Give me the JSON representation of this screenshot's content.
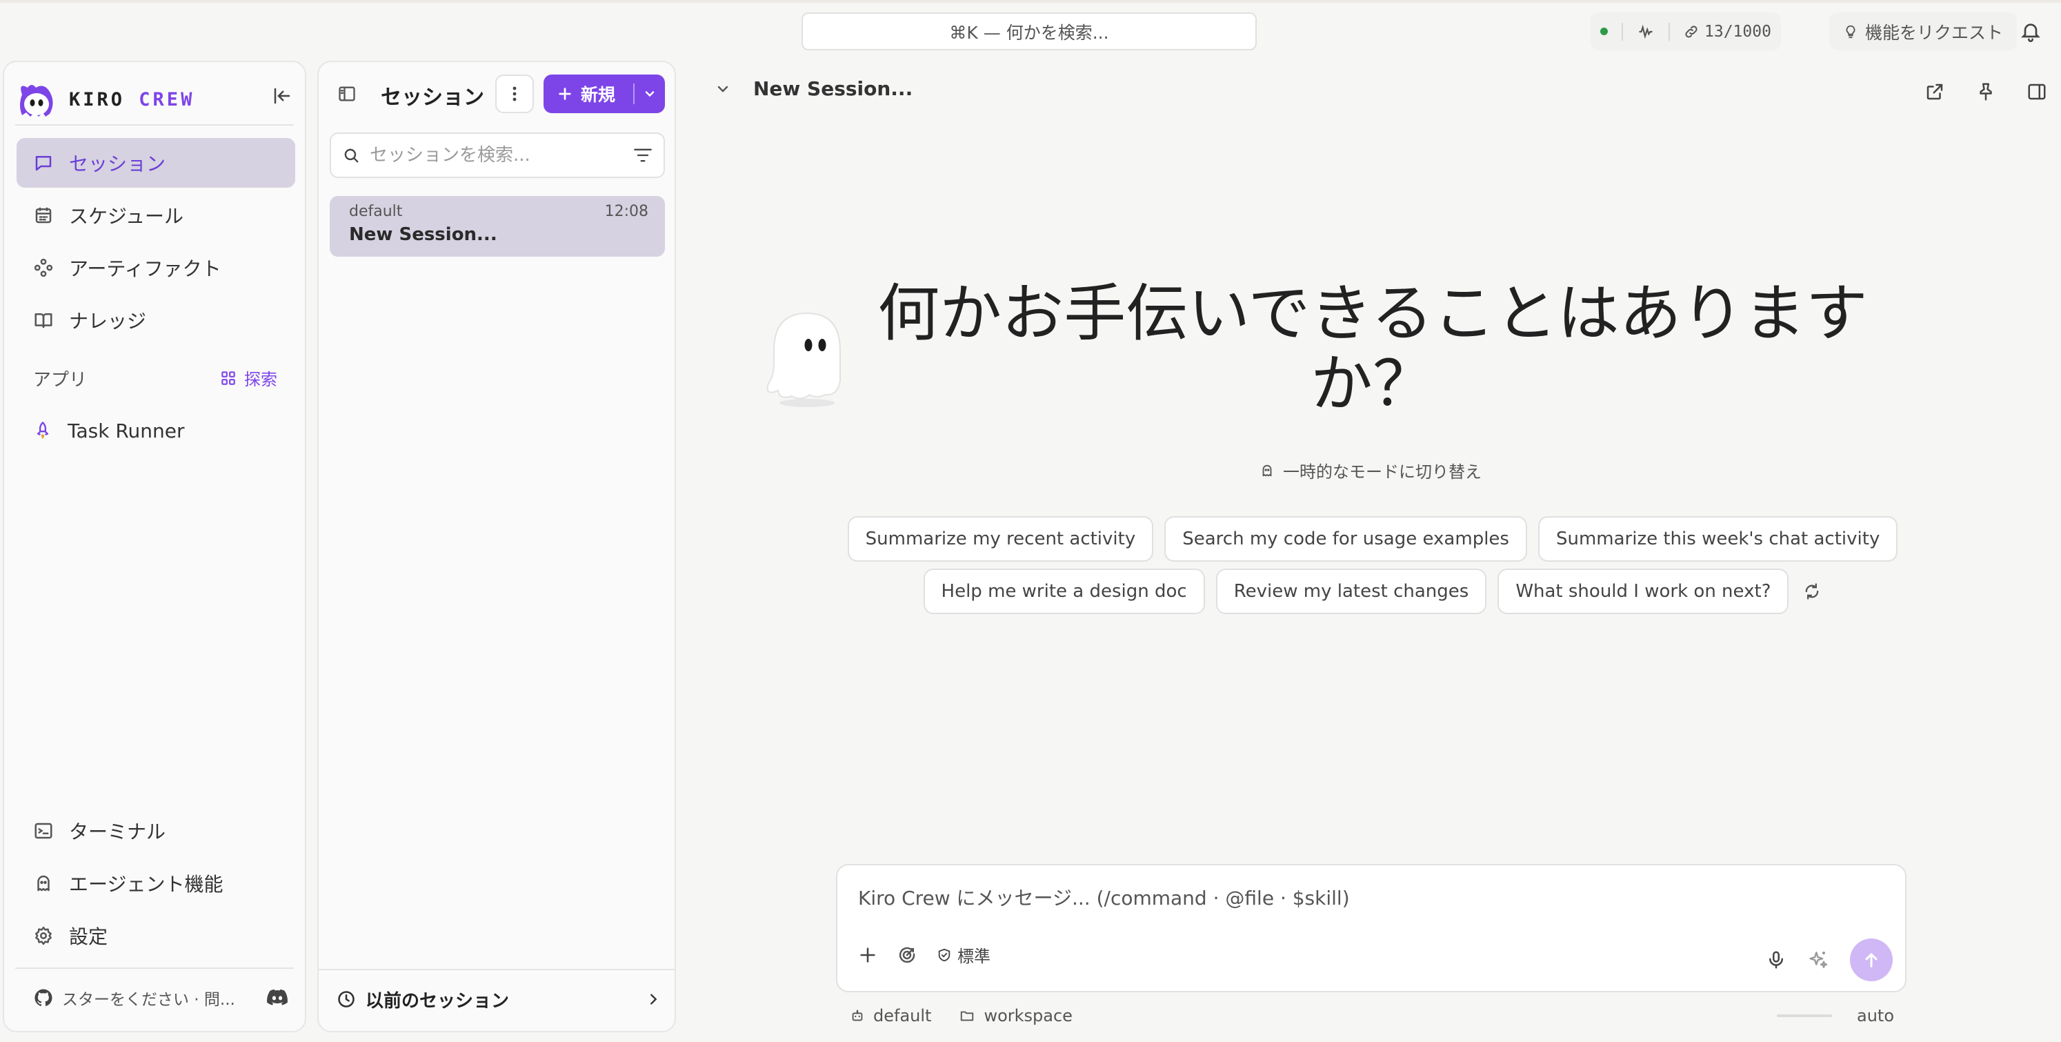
{
  "topbar": {
    "search_label": "⌘K — 何かを検索...",
    "usage": "13/1000",
    "request_feature": "機能をリクエスト"
  },
  "colors": {
    "accent": "#7d45e8",
    "active_bg": "#d6d2e1",
    "status_ok": "#2e9a47"
  },
  "brand": {
    "name_part1": "KIRO",
    "name_part2": "CREW"
  },
  "sidebar": {
    "items": [
      {
        "label": "セッション",
        "icon": "chat-bubble-icon",
        "active": true
      },
      {
        "label": "スケジュール",
        "icon": "calendar-icon"
      },
      {
        "label": "アーティファクト",
        "icon": "artifact-icon"
      },
      {
        "label": "ナレッジ",
        "icon": "book-open-icon"
      }
    ],
    "apps_label": "アプリ",
    "explore_label": "探索",
    "apps": [
      {
        "label": "Task Runner",
        "icon": "rocket-icon"
      }
    ],
    "bottom_items": [
      {
        "label": "ターミナル",
        "icon": "terminal-icon"
      },
      {
        "label": "エージェント機能",
        "icon": "ghost-icon"
      },
      {
        "label": "設定",
        "icon": "gear-icon"
      }
    ],
    "github_text": "スターをください · 問..."
  },
  "sessions_panel": {
    "title": "セッション",
    "new_label": "新規",
    "search_placeholder": "セッションを検索...",
    "items": [
      {
        "workspace": "default",
        "time": "12:08",
        "title": "New Session..."
      }
    ],
    "previous_label": "以前のセッション"
  },
  "main": {
    "session_name": "New Session...",
    "greeting": "何かお手伝いできることはありますか？",
    "temp_mode": "一時的なモードに切り替え",
    "suggestions_row1": [
      "Summarize my recent activity",
      "Search my code for usage examples",
      "Summarize this week's chat activity"
    ],
    "suggestions_row2": [
      "Help me write a design doc",
      "Review my latest changes",
      "What should I work on next?"
    ],
    "composer_placeholder": "Kiro Crew にメッセージ... (/command · @file · $skill)",
    "mode_label": "標準",
    "footer": {
      "agent": "default",
      "folder": "workspace",
      "model": "auto"
    }
  }
}
